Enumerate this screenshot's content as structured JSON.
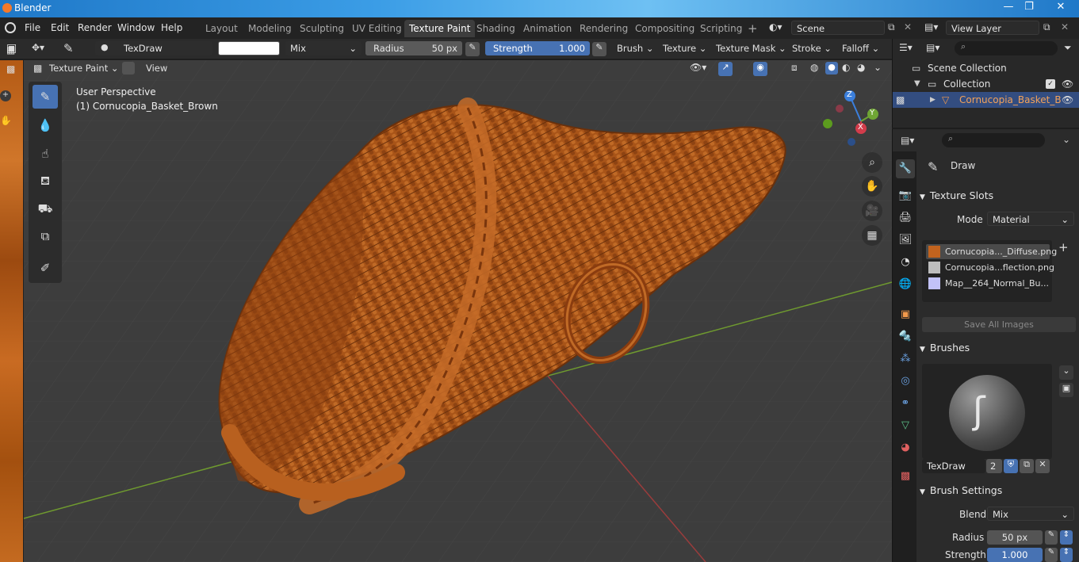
{
  "window": {
    "title": "Blender",
    "minimize": "—",
    "maximize": "❐",
    "close": "✕"
  },
  "menubar": {
    "items": [
      "File",
      "Edit",
      "Render",
      "Window",
      "Help"
    ]
  },
  "workspaces": {
    "tabs": [
      "Layout",
      "Modeling",
      "Sculpting",
      "UV Editing",
      "Texture Paint",
      "Shading",
      "Animation",
      "Rendering",
      "Compositing",
      "Scripting"
    ],
    "add": "+"
  },
  "scene": {
    "name": "Scene",
    "view_layer": "View Layer"
  },
  "toolheader": {
    "brush_name": "TexDraw",
    "blend": "Mix",
    "radius_label": "Radius",
    "radius_value": "50 px",
    "strength_label": "Strength",
    "strength_value": "1.000",
    "brush": "Brush",
    "texture": "Texture",
    "texture_mask": "Texture Mask",
    "stroke": "Stroke",
    "falloff": "Falloff"
  },
  "modeheader": {
    "mode": "Texture Paint",
    "view": "View"
  },
  "viewport": {
    "perspective": "User Perspective",
    "object": "(1) Cornucopia_Basket_Brown"
  },
  "gizmo": {
    "z": "Z",
    "y": "Y",
    "x": "X"
  },
  "outliner": {
    "scene_collection": "Scene Collection",
    "collection": "Collection",
    "object": "Cornucopia_Basket_B"
  },
  "properties": {
    "tool": "Draw",
    "texture_slots": {
      "title": "Texture Slots",
      "mode_label": "Mode",
      "mode": "Material",
      "slots": [
        "Cornucopia..._Diffuse.png",
        "Cornucopia...flection.png",
        "Map__264_Normal_Bu..."
      ],
      "save_all": "Save All Images"
    },
    "brushes": {
      "title": "Brushes",
      "brush_name": "TexDraw",
      "users": "2"
    },
    "brush_settings": {
      "title": "Brush Settings",
      "blend_label": "Blend",
      "blend": "Mix",
      "radius_label": "Radius",
      "radius": "50 px",
      "strength_label": "Strength",
      "strength": "1.000"
    }
  },
  "colors": {
    "accent": "#4772b3",
    "basket": "#b35a18",
    "grid_x": "#8a3a3a",
    "grid_y": "#5f8a2a"
  }
}
